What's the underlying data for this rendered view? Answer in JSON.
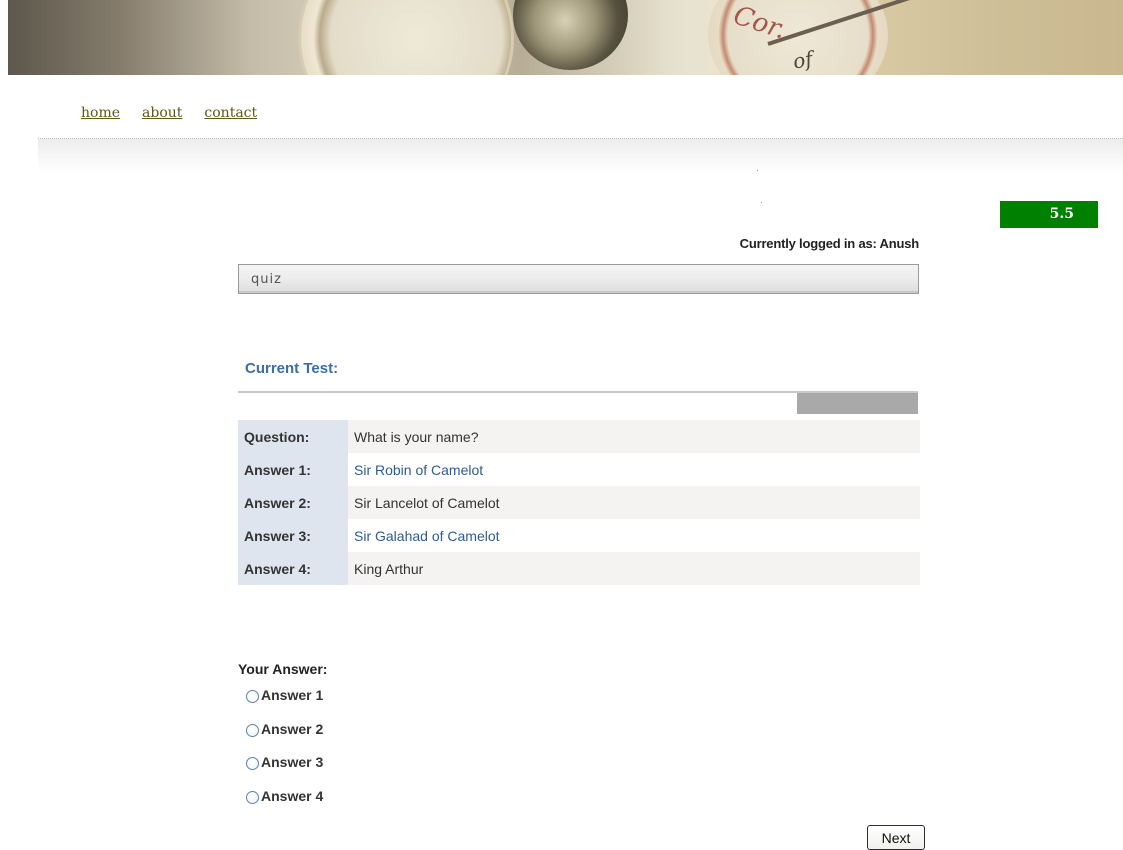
{
  "banner": {
    "script_text_1": "Cor.",
    "script_text_2": "of"
  },
  "nav": {
    "home": "home",
    "about": "about",
    "contact": "contact"
  },
  "score": "5.5",
  "user": {
    "logged_in_text": "Currently logged in as: Anush"
  },
  "section_title": "quiz",
  "current_test_label": "Current Test:",
  "question": {
    "label": "Question:",
    "text": "What is your name?"
  },
  "answers": [
    {
      "label": "Answer 1:",
      "text": "Sir Robin of Camelot"
    },
    {
      "label": "Answer 2:",
      "text": "Sir Lancelot of Camelot"
    },
    {
      "label": "Answer 3:",
      "text": "Sir Galahad of Camelot"
    },
    {
      "label": "Answer 4:",
      "text": "King Arthur"
    }
  ],
  "your_answer_label": "Your Answer:",
  "options": [
    "Answer 1",
    "Answer 2",
    "Answer 3",
    "Answer 4"
  ],
  "next_button": "Next"
}
